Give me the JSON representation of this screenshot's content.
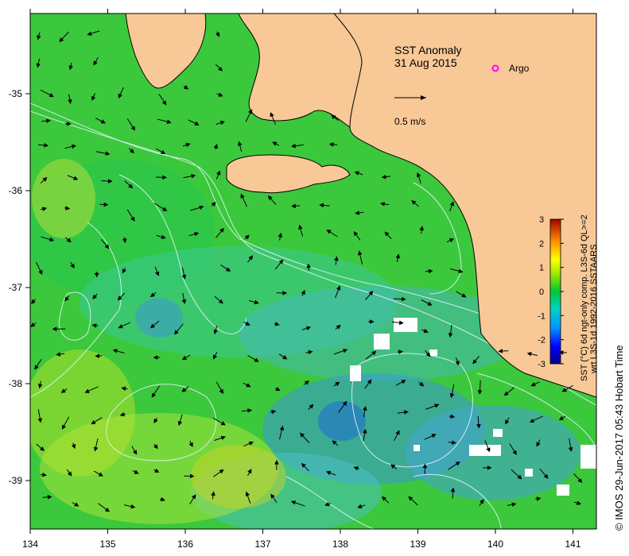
{
  "title": "SST Anomaly",
  "date": "31 Aug 2015",
  "argo_label": "Argo",
  "scale_label": "0.5 m/s",
  "x_ticks": [
    "134",
    "135",
    "136",
    "137",
    "138",
    "139",
    "140",
    "141"
  ],
  "y_ticks": [
    "-35",
    "-36",
    "-37",
    "-38",
    "-39"
  ],
  "colorbar": {
    "ticks": [
      "3",
      "2",
      "1",
      "0",
      "-1",
      "-2",
      "-3"
    ],
    "label_line1": "SST (°C) 6d ngt-only comp. L3S-6d QL>=2",
    "label_line2": "wrt L3S-1d 1992-2016 SSTAARS"
  },
  "credit": "© IMOS 29-Jun-2017 05:43 Hobart Time",
  "colors": {
    "land": "#f8c896",
    "ocean_base": "#3cc83c",
    "argo": "#ff00ff",
    "contour": "#e8f4ff"
  }
}
